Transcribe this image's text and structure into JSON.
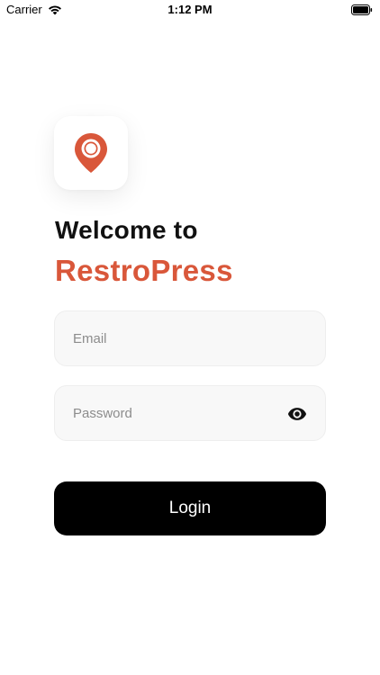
{
  "status_bar": {
    "carrier": "Carrier",
    "time": "1:12 PM",
    "wifi_icon": "wifi-icon",
    "battery_icon": "battery-full-icon"
  },
  "logo": {
    "icon": "location-pin-plate-icon",
    "accent_color": "#d9573a"
  },
  "heading": {
    "welcome": "Welcome to",
    "brand": "RestroPress",
    "brand_color": "#d9573a"
  },
  "form": {
    "email": {
      "placeholder": "Email",
      "value": ""
    },
    "password": {
      "placeholder": "Password",
      "value": "",
      "toggle_icon": "eye-icon"
    },
    "login_label": "Login"
  }
}
